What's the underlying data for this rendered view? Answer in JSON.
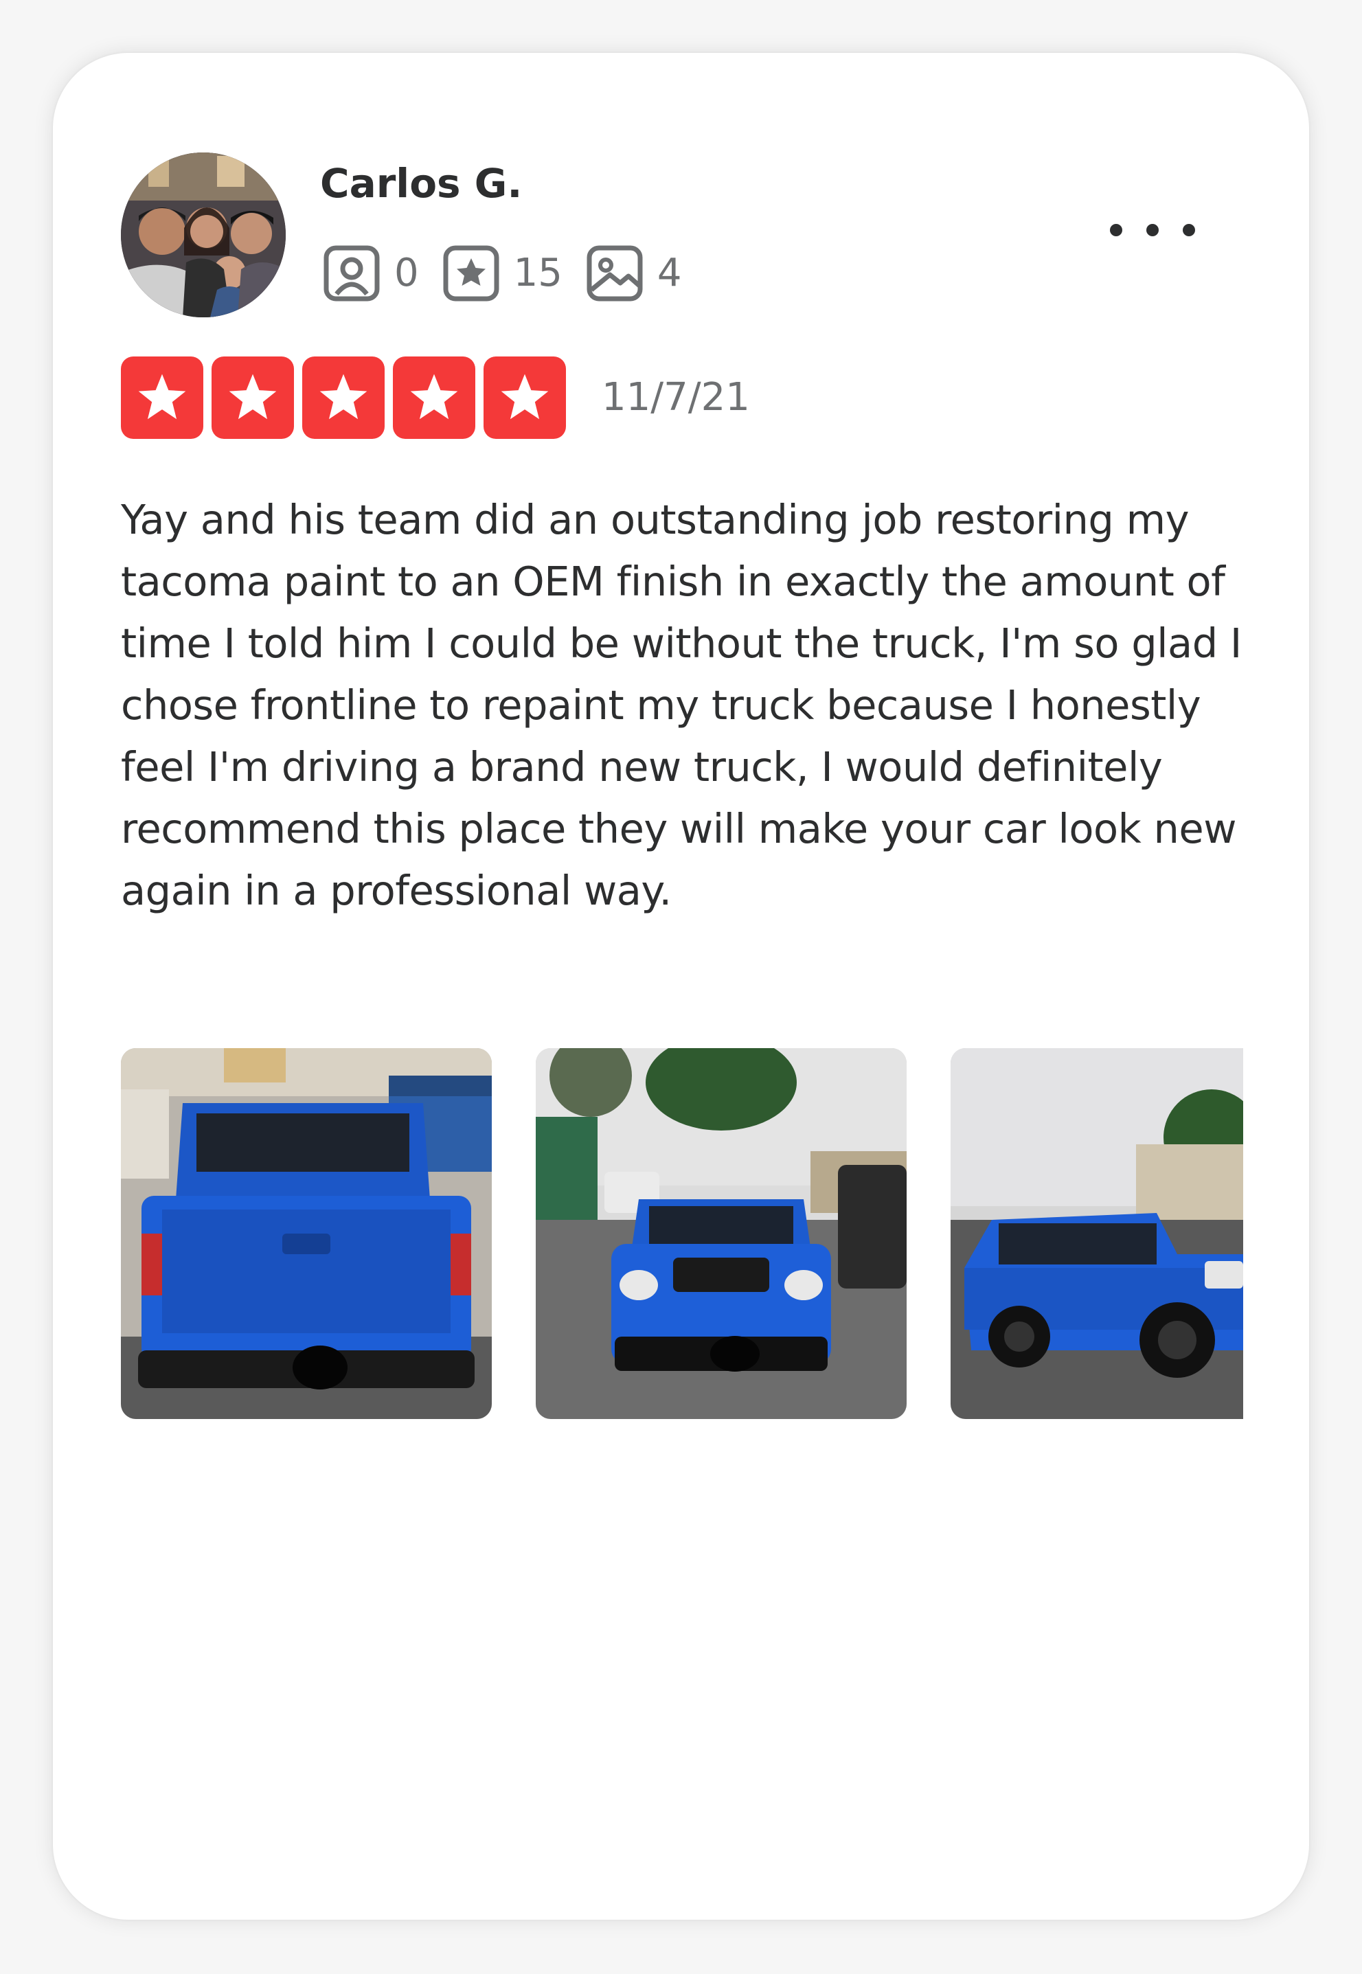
{
  "review": {
    "author": {
      "name": "Carlos G.",
      "avatar_icon": "user-avatar-photo"
    },
    "stats": [
      {
        "icon": "friends-icon",
        "count": "0"
      },
      {
        "icon": "reviews-star-icon",
        "count": "15"
      },
      {
        "icon": "photos-icon",
        "count": "4"
      }
    ],
    "more_icon": "more-horizontal-icon",
    "rating": {
      "stars": 5,
      "max": 5,
      "color": "#f43939"
    },
    "date": "11/7/21",
    "text": "Yay and his team did an outstanding job restoring my tacoma paint to an OEM finish in exactly the amount of time I told him I could be without the truck, I'm so glad I chose frontline to repaint my truck because I honestly feel I'm driving a brand new truck, I would definitely recommend this place they will make your car look new again in a professional way.",
    "photos": [
      {
        "subject": "blue truck rear view"
      },
      {
        "subject": "blue truck front view"
      },
      {
        "subject": "blue truck side view"
      }
    ]
  }
}
